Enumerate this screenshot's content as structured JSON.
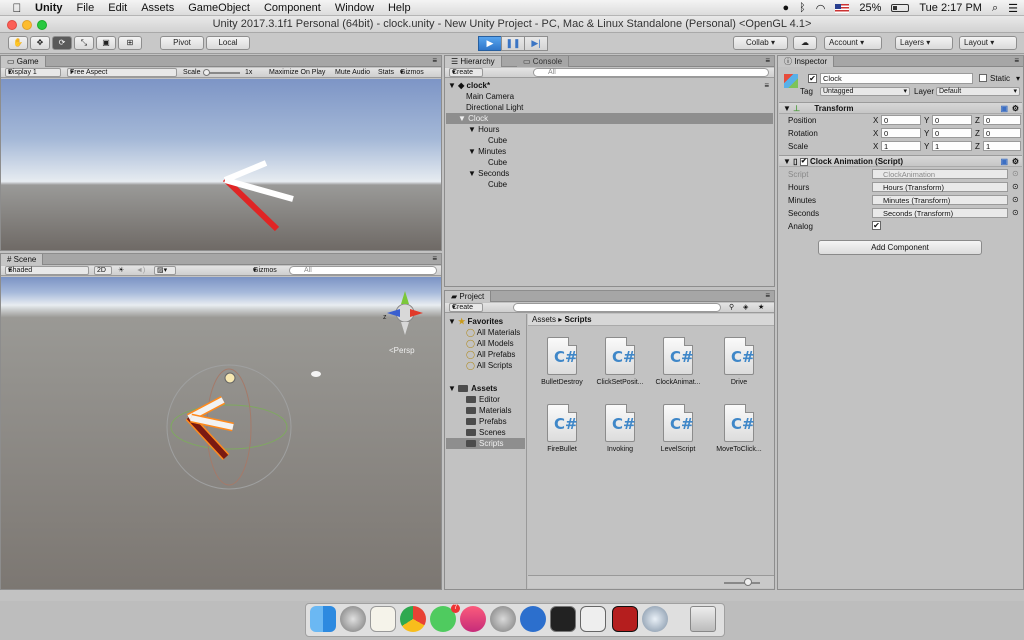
{
  "menubar": {
    "apple": "",
    "items": [
      "Unity",
      "File",
      "Edit",
      "Assets",
      "GameObject",
      "Component",
      "Window",
      "Help"
    ],
    "battery": "25%",
    "clock": "Tue 2:17 PM"
  },
  "window": {
    "title": "Unity 2017.3.1f1 Personal (64bit) - clock.unity - New Unity Project - PC, Mac & Linux Standalone (Personal) <OpenGL 4.1>"
  },
  "toolbar": {
    "pivot": "Pivot",
    "local": "Local",
    "collab": "Collab",
    "account": "Account",
    "layers": "Layers",
    "layout": "Layout"
  },
  "game": {
    "tab": "Game",
    "display": "Display 1",
    "aspect": "Free Aspect",
    "scale_label": "Scale",
    "scale_value": "1x",
    "maximize": "Maximize On Play",
    "mute": "Mute Audio",
    "stats": "Stats",
    "gizmos": "Gizmos"
  },
  "scene": {
    "tab": "Scene",
    "shading": "Shaded",
    "mode2d": "2D",
    "gizmos": "Gizmos",
    "search": "All",
    "persp": "Persp"
  },
  "hierarchy": {
    "tab": "Hierarchy",
    "console_tab": "Console",
    "create": "Create",
    "search": "All",
    "root": "clock*",
    "rows": [
      "Main Camera",
      "Directional Light",
      "Clock",
      "Hours",
      "Cube",
      "Minutes",
      "Cube",
      "Seconds",
      "Cube"
    ]
  },
  "project": {
    "tab": "Project",
    "create": "Create",
    "favorites": "Favorites",
    "fav_items": [
      "All Materials",
      "All Models",
      "All Prefabs",
      "All Scripts"
    ],
    "assets": "Assets",
    "folders": [
      "Editor",
      "Materials",
      "Prefabs",
      "Scenes",
      "Scripts"
    ],
    "breadcrumb_root": "Assets",
    "breadcrumb_leaf": "Scripts",
    "scripts": [
      "BulletDestroy",
      "ClickSetPosit...",
      "ClockAnimat...",
      "Drive",
      "FireBullet",
      "Invoking",
      "LevelScript",
      "MoveToClick..."
    ]
  },
  "inspector": {
    "tab": "Inspector",
    "name": "Clock",
    "static": "Static",
    "tag_label": "Tag",
    "tag": "Untagged",
    "layer_label": "Layer",
    "layer": "Default",
    "transform": {
      "title": "Transform",
      "position_label": "Position",
      "rotation_label": "Rotation",
      "scale_label": "Scale",
      "position": [
        "0",
        "0",
        "0"
      ],
      "rotation": [
        "0",
        "0",
        "0"
      ],
      "scale": [
        "1",
        "1",
        "1"
      ]
    },
    "script": {
      "title": "Clock Animation (Script)",
      "script_label": "Script",
      "script_value": "ClockAnimation",
      "hours_label": "Hours",
      "hours_value": "Hours (Transform)",
      "minutes_label": "Minutes",
      "minutes_value": "Minutes (Transform)",
      "seconds_label": "Seconds",
      "seconds_value": "Seconds (Transform)",
      "analog_label": "Analog"
    },
    "add_component": "Add Component"
  },
  "colors": {
    "selection": "#8e8e8e",
    "play_blue": "#3d8ae0",
    "accent_red": "#e02525"
  }
}
